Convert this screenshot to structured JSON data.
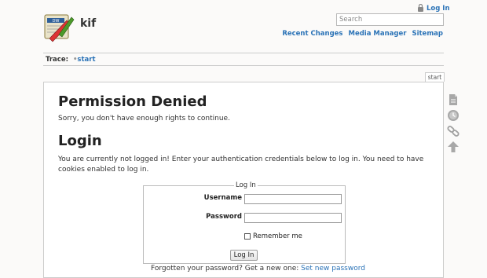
{
  "site": {
    "title": "kif",
    "logo_icon": "dokuwiki-logo-icon"
  },
  "user": {
    "login_label": "Log In",
    "login_icon": "lock-icon"
  },
  "search": {
    "placeholder": "Search"
  },
  "nav": {
    "recent_changes": "Recent Changes",
    "media_manager": "Media Manager",
    "sitemap": "Sitemap"
  },
  "breadcrumb": {
    "label": "Trace:",
    "separator": "•",
    "current": "start"
  },
  "page": {
    "tab_label": "start",
    "denied_title": "Permission Denied",
    "denied_text": "Sorry, you don't have enough rights to continue.",
    "login_title": "Login",
    "login_intro": "You are currently not logged in! Enter your authentication credentials below to log in. You need to have cookies enabled to log in."
  },
  "form": {
    "legend": "Log In",
    "username_label": "Username",
    "username_value": "",
    "password_label": "Password",
    "password_value": "",
    "remember_label": "Remember me",
    "remember_checked": false,
    "submit_label": "Log In"
  },
  "forgot": {
    "text": "Forgotten your password? Get a new one:",
    "link": "Set new password"
  },
  "page_tools": [
    "show-source-icon",
    "old-revisions-icon",
    "backlinks-icon",
    "back-to-top-icon"
  ],
  "colors": {
    "link": "#2b73b7",
    "background": "#fbfaf9",
    "content_bg": "#ffffff"
  }
}
